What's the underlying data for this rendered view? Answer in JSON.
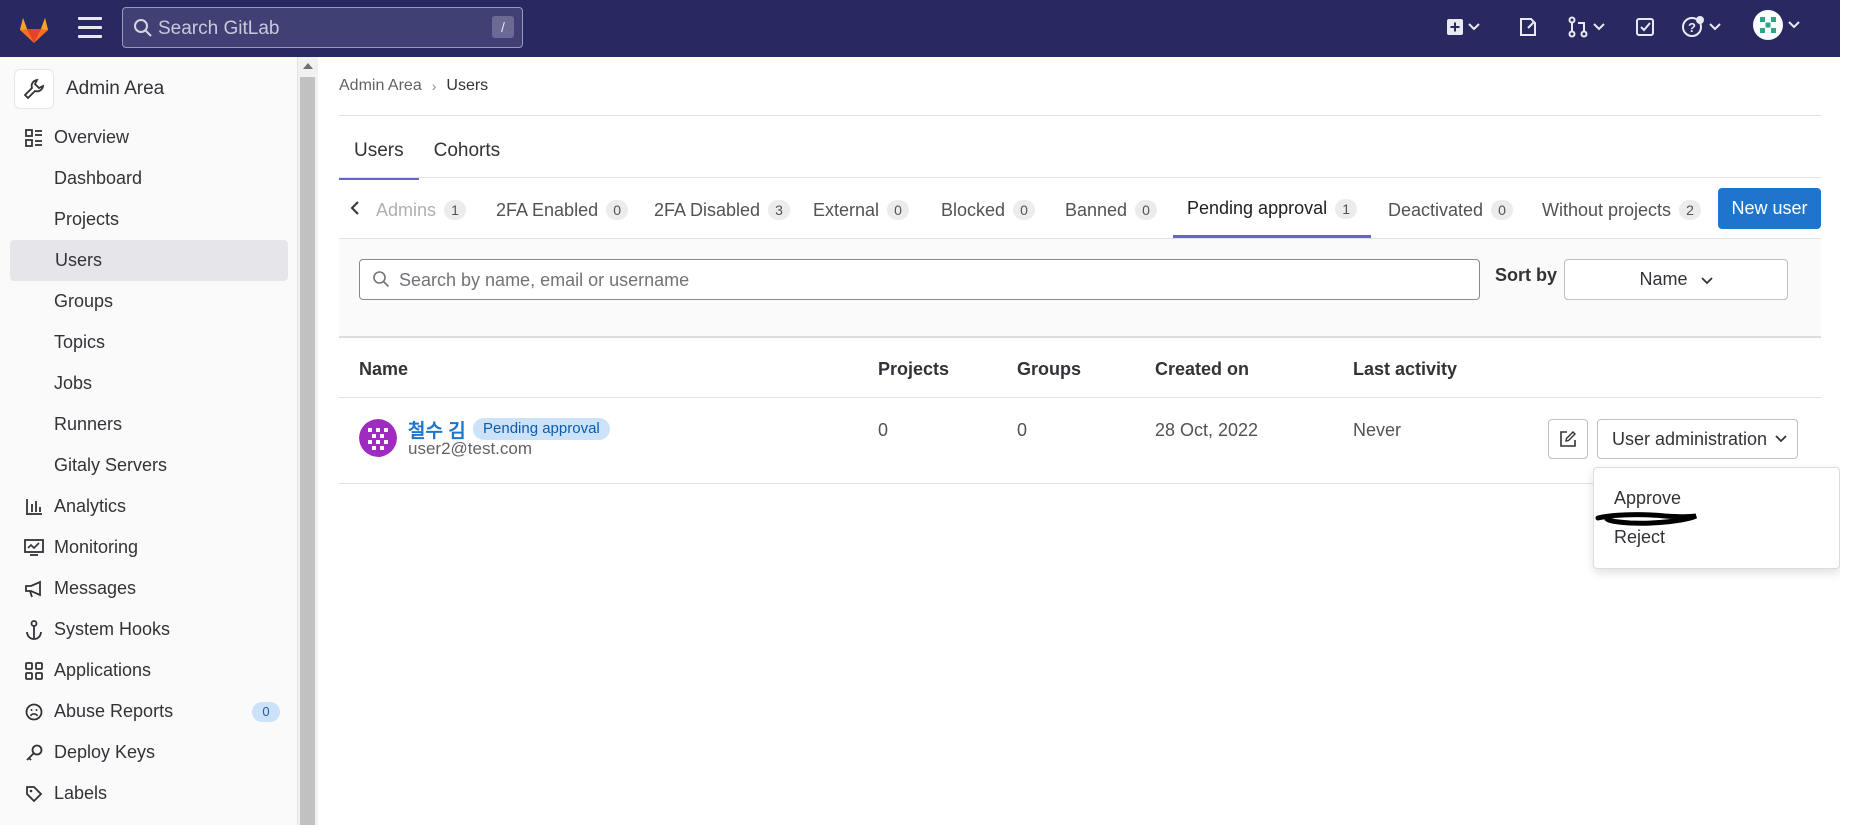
{
  "topbar": {
    "search_placeholder": "Search GitLab",
    "search_shortcut": "/",
    "icons": [
      "gitlab-logo",
      "hamburger-icon",
      "search-icon",
      "new-item-icon",
      "issues-icon",
      "merge-requests-icon",
      "todos-icon",
      "help-icon",
      "user-avatar"
    ]
  },
  "sidebar": {
    "title": "Admin Area",
    "items": [
      {
        "label": "Overview",
        "icon": "overview-icon",
        "level": "top"
      },
      {
        "label": "Dashboard",
        "level": "sub"
      },
      {
        "label": "Projects",
        "level": "sub"
      },
      {
        "label": "Users",
        "level": "sub",
        "active": true
      },
      {
        "label": "Groups",
        "level": "sub"
      },
      {
        "label": "Topics",
        "level": "sub"
      },
      {
        "label": "Jobs",
        "level": "sub"
      },
      {
        "label": "Runners",
        "level": "sub"
      },
      {
        "label": "Gitaly Servers",
        "level": "sub"
      },
      {
        "label": "Analytics",
        "icon": "analytics-icon",
        "level": "top"
      },
      {
        "label": "Monitoring",
        "icon": "monitoring-icon",
        "level": "top"
      },
      {
        "label": "Messages",
        "icon": "messages-icon",
        "level": "top"
      },
      {
        "label": "System Hooks",
        "icon": "hook-icon",
        "level": "top"
      },
      {
        "label": "Applications",
        "icon": "applications-icon",
        "level": "top"
      },
      {
        "label": "Abuse Reports",
        "icon": "abuse-icon",
        "level": "top",
        "badge": "0"
      },
      {
        "label": "Deploy Keys",
        "icon": "key-icon",
        "level": "top"
      },
      {
        "label": "Labels",
        "icon": "label-icon",
        "level": "top"
      }
    ]
  },
  "breadcrumb": {
    "root": "Admin Area",
    "current": "Users"
  },
  "tabs": [
    "Users",
    "Cohorts"
  ],
  "filter_tabs": [
    {
      "label": "Admins",
      "count": "1"
    },
    {
      "label": "2FA Enabled",
      "count": "0"
    },
    {
      "label": "2FA Disabled",
      "count": "3"
    },
    {
      "label": "External",
      "count": "0"
    },
    {
      "label": "Blocked",
      "count": "0"
    },
    {
      "label": "Banned",
      "count": "0"
    },
    {
      "label": "Pending approval",
      "count": "1",
      "active": true
    },
    {
      "label": "Deactivated",
      "count": "0"
    },
    {
      "label": "Without projects",
      "count": "2"
    }
  ],
  "new_user_label": "New user",
  "search": {
    "placeholder": "Search by name, email or username"
  },
  "sort": {
    "label": "Sort by",
    "value": "Name"
  },
  "table": {
    "headers": [
      "Name",
      "Projects",
      "Groups",
      "Created on",
      "Last activity"
    ],
    "rows": [
      {
        "name": "철수 김",
        "badge": "Pending approval",
        "email": "user2@test.com",
        "projects": "0",
        "groups": "0",
        "created_on": "28 Oct, 2022",
        "last_activity": "Never"
      }
    ]
  },
  "user_admin_button": "User administration",
  "dropdown": {
    "items": [
      "Approve",
      "Reject"
    ]
  },
  "colors": {
    "topbar": "#292961",
    "primary": "#1f75cb",
    "active_tab": "#6666c4",
    "badge_bg": "#cbe2f9"
  }
}
